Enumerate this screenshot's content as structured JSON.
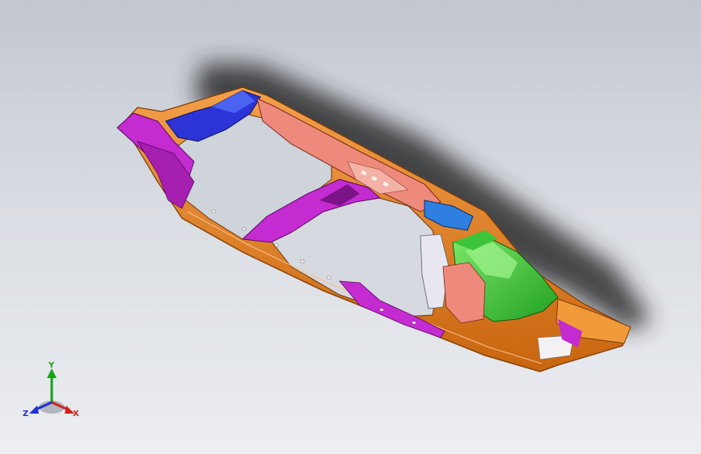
{
  "viewport": {
    "background_top": "#c2c7d0",
    "background_bottom": "#eceef1"
  },
  "model": {
    "part_colors": {
      "frame": "#e8821e",
      "left_panel": "#c42bd0",
      "top_left_block": "#2c34d8",
      "top_beam": "#ee8a7c",
      "blue_bracket": "#2f7fe0",
      "right_module": "#3ec43a",
      "shadow": "#2a2a2a"
    }
  },
  "triad": {
    "y_label": "Y",
    "z_label": "Z",
    "x_label": "X",
    "y_color": "#1aa01a",
    "x_color": "#d22020",
    "z_color": "#2030d0"
  }
}
